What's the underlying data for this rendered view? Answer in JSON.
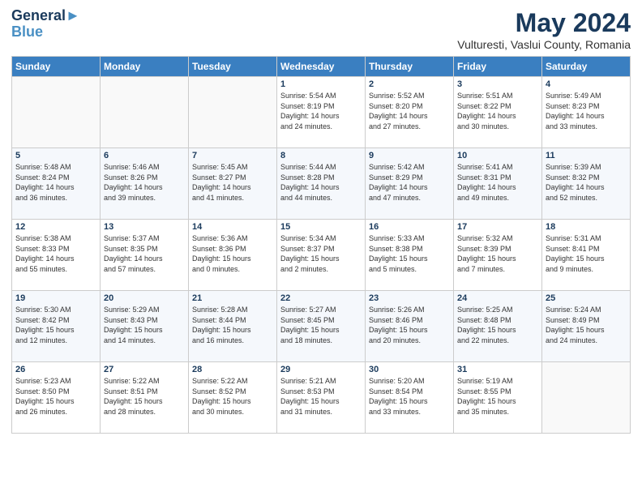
{
  "header": {
    "logo_line1": "General",
    "logo_line2": "Blue",
    "title": "May 2024",
    "subtitle": "Vulturesti, Vaslui County, Romania"
  },
  "columns": [
    "Sunday",
    "Monday",
    "Tuesday",
    "Wednesday",
    "Thursday",
    "Friday",
    "Saturday"
  ],
  "weeks": [
    [
      {
        "day": "",
        "info": ""
      },
      {
        "day": "",
        "info": ""
      },
      {
        "day": "",
        "info": ""
      },
      {
        "day": "1",
        "info": "Sunrise: 5:54 AM\nSunset: 8:19 PM\nDaylight: 14 hours\nand 24 minutes."
      },
      {
        "day": "2",
        "info": "Sunrise: 5:52 AM\nSunset: 8:20 PM\nDaylight: 14 hours\nand 27 minutes."
      },
      {
        "day": "3",
        "info": "Sunrise: 5:51 AM\nSunset: 8:22 PM\nDaylight: 14 hours\nand 30 minutes."
      },
      {
        "day": "4",
        "info": "Sunrise: 5:49 AM\nSunset: 8:23 PM\nDaylight: 14 hours\nand 33 minutes."
      }
    ],
    [
      {
        "day": "5",
        "info": "Sunrise: 5:48 AM\nSunset: 8:24 PM\nDaylight: 14 hours\nand 36 minutes."
      },
      {
        "day": "6",
        "info": "Sunrise: 5:46 AM\nSunset: 8:26 PM\nDaylight: 14 hours\nand 39 minutes."
      },
      {
        "day": "7",
        "info": "Sunrise: 5:45 AM\nSunset: 8:27 PM\nDaylight: 14 hours\nand 41 minutes."
      },
      {
        "day": "8",
        "info": "Sunrise: 5:44 AM\nSunset: 8:28 PM\nDaylight: 14 hours\nand 44 minutes."
      },
      {
        "day": "9",
        "info": "Sunrise: 5:42 AM\nSunset: 8:29 PM\nDaylight: 14 hours\nand 47 minutes."
      },
      {
        "day": "10",
        "info": "Sunrise: 5:41 AM\nSunset: 8:31 PM\nDaylight: 14 hours\nand 49 minutes."
      },
      {
        "day": "11",
        "info": "Sunrise: 5:39 AM\nSunset: 8:32 PM\nDaylight: 14 hours\nand 52 minutes."
      }
    ],
    [
      {
        "day": "12",
        "info": "Sunrise: 5:38 AM\nSunset: 8:33 PM\nDaylight: 14 hours\nand 55 minutes."
      },
      {
        "day": "13",
        "info": "Sunrise: 5:37 AM\nSunset: 8:35 PM\nDaylight: 14 hours\nand 57 minutes."
      },
      {
        "day": "14",
        "info": "Sunrise: 5:36 AM\nSunset: 8:36 PM\nDaylight: 15 hours\nand 0 minutes."
      },
      {
        "day": "15",
        "info": "Sunrise: 5:34 AM\nSunset: 8:37 PM\nDaylight: 15 hours\nand 2 minutes."
      },
      {
        "day": "16",
        "info": "Sunrise: 5:33 AM\nSunset: 8:38 PM\nDaylight: 15 hours\nand 5 minutes."
      },
      {
        "day": "17",
        "info": "Sunrise: 5:32 AM\nSunset: 8:39 PM\nDaylight: 15 hours\nand 7 minutes."
      },
      {
        "day": "18",
        "info": "Sunrise: 5:31 AM\nSunset: 8:41 PM\nDaylight: 15 hours\nand 9 minutes."
      }
    ],
    [
      {
        "day": "19",
        "info": "Sunrise: 5:30 AM\nSunset: 8:42 PM\nDaylight: 15 hours\nand 12 minutes."
      },
      {
        "day": "20",
        "info": "Sunrise: 5:29 AM\nSunset: 8:43 PM\nDaylight: 15 hours\nand 14 minutes."
      },
      {
        "day": "21",
        "info": "Sunrise: 5:28 AM\nSunset: 8:44 PM\nDaylight: 15 hours\nand 16 minutes."
      },
      {
        "day": "22",
        "info": "Sunrise: 5:27 AM\nSunset: 8:45 PM\nDaylight: 15 hours\nand 18 minutes."
      },
      {
        "day": "23",
        "info": "Sunrise: 5:26 AM\nSunset: 8:46 PM\nDaylight: 15 hours\nand 20 minutes."
      },
      {
        "day": "24",
        "info": "Sunrise: 5:25 AM\nSunset: 8:48 PM\nDaylight: 15 hours\nand 22 minutes."
      },
      {
        "day": "25",
        "info": "Sunrise: 5:24 AM\nSunset: 8:49 PM\nDaylight: 15 hours\nand 24 minutes."
      }
    ],
    [
      {
        "day": "26",
        "info": "Sunrise: 5:23 AM\nSunset: 8:50 PM\nDaylight: 15 hours\nand 26 minutes."
      },
      {
        "day": "27",
        "info": "Sunrise: 5:22 AM\nSunset: 8:51 PM\nDaylight: 15 hours\nand 28 minutes."
      },
      {
        "day": "28",
        "info": "Sunrise: 5:22 AM\nSunset: 8:52 PM\nDaylight: 15 hours\nand 30 minutes."
      },
      {
        "day": "29",
        "info": "Sunrise: 5:21 AM\nSunset: 8:53 PM\nDaylight: 15 hours\nand 31 minutes."
      },
      {
        "day": "30",
        "info": "Sunrise: 5:20 AM\nSunset: 8:54 PM\nDaylight: 15 hours\nand 33 minutes."
      },
      {
        "day": "31",
        "info": "Sunrise: 5:19 AM\nSunset: 8:55 PM\nDaylight: 15 hours\nand 35 minutes."
      },
      {
        "day": "",
        "info": ""
      }
    ]
  ]
}
